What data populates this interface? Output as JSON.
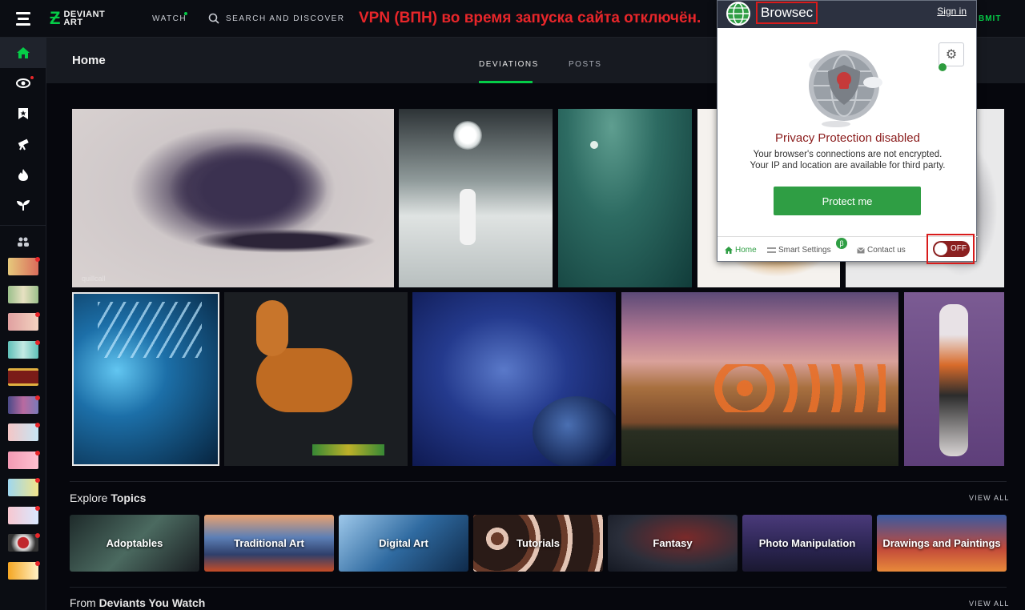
{
  "topbar": {
    "logo_text": "DEVIANT\nART",
    "watch_label": "WATCH",
    "search_placeholder": "SEARCH AND DISCOVER",
    "vpn_message": "VPN (ВПН) во время запуска сайта отключён.",
    "submit_tail": "BMIT"
  },
  "colors": {
    "brand_green": "#05cc47",
    "alert_red": "#e8262a",
    "browsec_green": "#2f9e44"
  },
  "rail": {
    "icons": [
      "home-icon",
      "eye-icon",
      "bookmark-icon",
      "telescope-icon",
      "flame-icon",
      "sprout-icon"
    ],
    "groups_icon": "groups-icon"
  },
  "home": {
    "title": "Home",
    "tabs": [
      {
        "label": "DEVIATIONS",
        "active": true
      },
      {
        "label": "POSTS",
        "active": false
      }
    ]
  },
  "gallery": {
    "watermark_1": "quillcall"
  },
  "explore": {
    "title_light": "Explore",
    "title_bold": "Topics",
    "view_all": "VIEW ALL",
    "topics": [
      "Adoptables",
      "Traditional Art",
      "Digital Art",
      "Tutorials",
      "Fantasy",
      "Photo Manipulation",
      "Drawings and Paintings"
    ]
  },
  "watching": {
    "title_light": "From",
    "title_bold": "Deviants You Watch",
    "view_all": "VIEW ALL"
  },
  "browsec": {
    "brand": "Browsec",
    "sign_in": "Sign in",
    "status": "Privacy Protection disabled",
    "desc_line1": "Your browser's connections are not encrypted.",
    "desc_line2": "Your IP and location are available for third party.",
    "protect_button": "Protect me",
    "footer": {
      "home": "Home",
      "smart_settings": "Smart Settings",
      "beta": "β",
      "contact": "Contact us"
    },
    "toggle_label": "OFF"
  }
}
